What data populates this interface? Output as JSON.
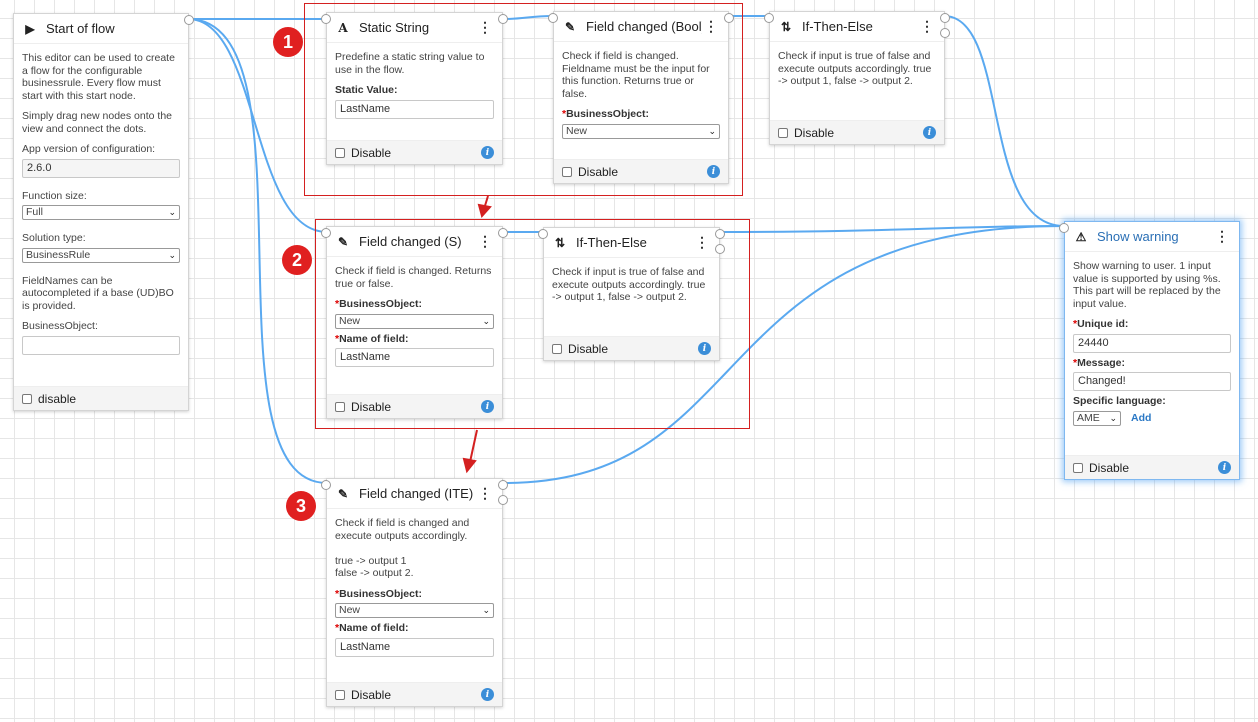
{
  "start": {
    "title": "Start of flow",
    "desc1": "This editor can be used to create a flow for the configurable businessrule. Every flow must start with this start node.",
    "desc2": "Simply drag new nodes onto the view and connect the dots.",
    "app_version_label": "App version of configuration:",
    "app_version_value": "2.6.0",
    "function_size_label": "Function size:",
    "function_size_value": "Full",
    "solution_type_label": "Solution type:",
    "solution_type_value": "BusinessRule",
    "fieldnames_note": "FieldNames can be autocompleted if a base (UD)BO is provided.",
    "bo_label": "BusinessObject:",
    "bo_value": "",
    "disable_label": "disable"
  },
  "static_string": {
    "title": "Static String",
    "desc": "Predefine a static string value to use in the flow.",
    "value_label": "Static Value:",
    "value": "LastName",
    "disable_label": "Disable"
  },
  "field_changed_bool": {
    "title": "Field changed (Bool)",
    "desc": "Check if field is changed. Fieldname must be the input for this function. Returns true or false.",
    "bo_label": "BusinessObject:",
    "bo_value": "New",
    "disable_label": "Disable"
  },
  "ite_1": {
    "title": "If-Then-Else",
    "desc": "Check if input is true of false and execute outputs accordingly. true -> output 1, false -> output 2.",
    "disable_label": "Disable"
  },
  "field_changed_s": {
    "title": "Field changed (S)",
    "desc": "Check if field is changed. Returns true or false.",
    "bo_label": "BusinessObject:",
    "bo_value": "New",
    "field_label": "Name of field:",
    "field_value": "LastName",
    "disable_label": "Disable"
  },
  "ite_2": {
    "title": "If-Then-Else",
    "desc": "Check if input is true of false and execute outputs accordingly. true -> output 1, false -> output 2.",
    "disable_label": "Disable"
  },
  "field_changed_ite": {
    "title": "Field changed (ITE)",
    "desc": "Check if field is changed and execute outputs accordingly.\n\ntrue -> output 1\nfalse -> output 2.",
    "bo_label": "BusinessObject:",
    "bo_value": "New",
    "field_label": "Name of field:",
    "field_value": "LastName",
    "disable_label": "Disable"
  },
  "show_warning": {
    "title": "Show warning",
    "desc": "Show warning to user. 1 input value is supported by using %s. This part will be replaced by the input value.",
    "unique_label": "Unique id:",
    "unique_value": "24440",
    "message_label": "Message:",
    "message_value": "Changed!",
    "lang_label": "Specific language:",
    "lang_value": "AME",
    "add_label": "Add",
    "disable_label": "Disable"
  },
  "badges": {
    "b1": "1",
    "b2": "2",
    "b3": "3"
  },
  "colors": {
    "wire": "#5aa9f0",
    "group_border": "#d42020",
    "badge": "#e02020",
    "info": "#3b8ed8"
  },
  "icons": {
    "start": "play-icon",
    "static": "text-a-icon",
    "field_changed": "edit-document-icon",
    "ite": "branch-icon",
    "warning": "warning-triangle-icon"
  }
}
